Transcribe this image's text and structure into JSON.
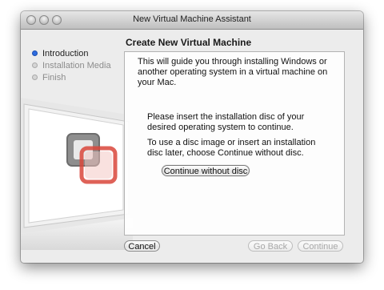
{
  "window": {
    "title": "New Virtual Machine Assistant"
  },
  "sidebar": {
    "steps": [
      {
        "label": "Introduction",
        "active": true
      },
      {
        "label": "Installation Media",
        "active": false
      },
      {
        "label": "Finish",
        "active": false
      }
    ]
  },
  "main": {
    "heading": "Create New Virtual Machine",
    "intro": "This will guide you through installing Windows or another operating system in a virtual machine on your Mac.",
    "insert_text": "Please insert the installation disc of your desired operating system to continue.",
    "alternative_text": "To use a disc image or insert an installation disc later, choose Continue without disc.",
    "continue_without_disc_label": "Continue without disc"
  },
  "footer": {
    "cancel_label": "Cancel",
    "go_back_label": "Go Back",
    "continue_label": "Continue"
  },
  "colors": {
    "accent": "#2e6ce0",
    "window_bg": "#ececec",
    "logo_red": "#d9463b"
  }
}
